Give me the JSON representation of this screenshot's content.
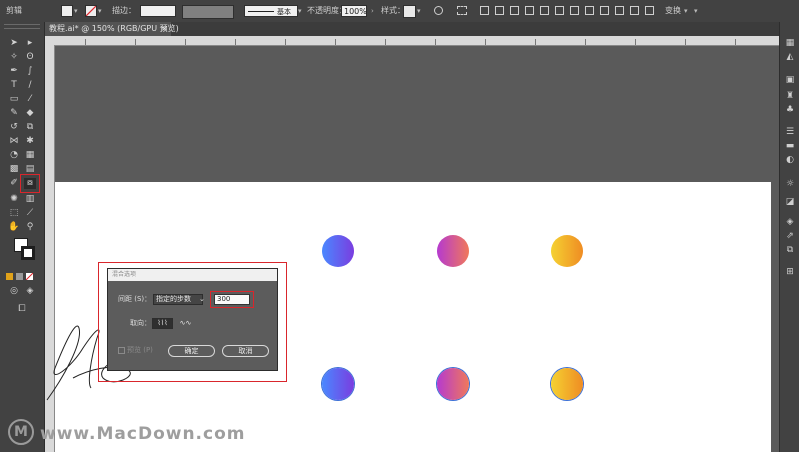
{
  "control_bar": {
    "left_label": "剪辑",
    "stroke_label": "描边：",
    "stroke_profile": "基本",
    "opacity_label": "不透明度：",
    "opacity_value": "100%",
    "style_label": "样式：",
    "transform_label": "变换"
  },
  "document_tab": {
    "title": "教程.ai* @ 150% (RGB/GPU 预览)",
    "close_glyph": "×"
  },
  "dialog": {
    "title": "混合选项",
    "spacing_label": "间距 (S)：",
    "spacing_value": "指定的步数",
    "steps_value": "300",
    "orientation_label": "取向：",
    "preview_label": "预览 (P)",
    "ok_label": "确定",
    "cancel_label": "取消"
  },
  "watermark": {
    "logo_glyph": "M",
    "text": "www.MacDown.com"
  },
  "colors": {
    "highlight": "#d9262c",
    "circle_blue_gradient": [
      "#4a88ff",
      "#7a3de0"
    ],
    "circle_magenta_gradient": [
      "#b53ad0",
      "#f0785a"
    ],
    "circle_orange_gradient": [
      "#f5d232",
      "#ef8c23"
    ]
  },
  "icons": [
    "selection-tool-icon",
    "direct-selection-tool-icon",
    "pen-tool-icon",
    "type-tool-icon",
    "blend-tool-icon",
    "hand-tool-icon",
    "zoom-tool-icon",
    "fill-stroke-icon",
    "layers-icon",
    "properties-icon",
    "chevron-down-icon",
    "close-icon"
  ]
}
